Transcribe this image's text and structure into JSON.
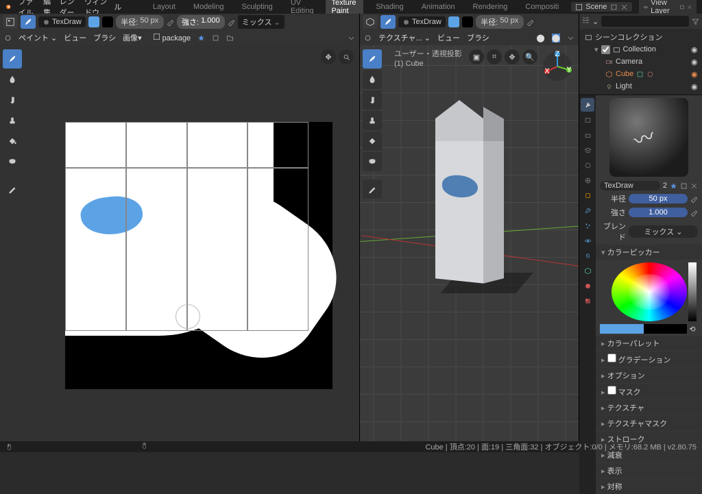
{
  "menu": {
    "file": "ファイル",
    "edit": "編集",
    "render": "レンダー",
    "window": "ウィンドウ",
    "help": "ヘルプ"
  },
  "workspaces": {
    "layout": "Layout",
    "modeling": "Modeling",
    "sculpting": "Sculpting",
    "uv": "UV Editing",
    "tex": "Texture Paint",
    "shading": "Shading",
    "anim": "Animation",
    "rendering": "Rendering",
    "comp": "Compositi"
  },
  "scene": {
    "label": "Scene"
  },
  "viewlayer": {
    "label": "View Layer"
  },
  "img_hdr": {
    "brush_name": "TexDraw",
    "radius_lab": "半径:",
    "radius_val": "50 px",
    "strength_lab": "強さ:",
    "strength_val": "1.000",
    "blend": "ミックス"
  },
  "img_hdr2": {
    "paint": "ペイント",
    "view": "ビュー",
    "brush": "ブラシ",
    "image": "画像",
    "image_name": "package"
  },
  "vp_hdr": {
    "brush_name": "TexDraw",
    "radius_lab": "半径:",
    "radius_val": "50 px"
  },
  "vp_hdr2": {
    "mode": "テクスチャ...",
    "view": "ビュー",
    "brush": "ブラシ"
  },
  "vp_info": {
    "line1": "ユーザー・透視投影",
    "line2": "(1) Cube"
  },
  "outliner": {
    "root": "シーンコレクション",
    "coll": "Collection",
    "items": [
      "Camera",
      "Cube",
      "Light"
    ]
  },
  "brush_panel": {
    "name": "TexDraw",
    "users": "2",
    "radius_lab": "半径",
    "radius_val": "50 px",
    "strength_lab": "強さ",
    "strength_val": "1.000",
    "blend_lab": "ブレンド",
    "blend_val": "ミックス",
    "picker_title": "カラーピッカー",
    "sections": [
      "カラーパレット",
      "グラデーション",
      "オプション",
      "マスク",
      "テクスチャ",
      "テクスチャマスク",
      "ストローク",
      "減衰",
      "表示",
      "対称"
    ]
  },
  "status": {
    "right": "Cube | 頂点:20 | 面:19 | 三角面:32 | オブジェクト:0/0 | メモリ:68.2 MB | v2.80.75"
  },
  "colors": {
    "accent": "#4a80c8",
    "blue_swatch": "#5ca3e6"
  }
}
